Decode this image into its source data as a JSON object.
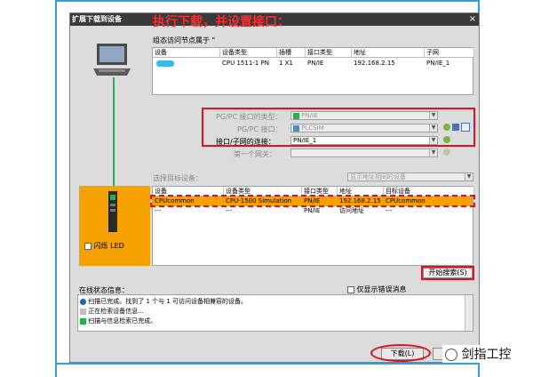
{
  "dialog": {
    "title": "扩展下载到设备",
    "close_glyph": "×"
  },
  "annotation": {
    "title": "执行下载，并设置接口："
  },
  "config_section": {
    "heading": "组态访问节点属于 \"",
    "columns": [
      "设备",
      "设备类型",
      "插槽",
      "接口类型",
      "地址",
      "子网"
    ],
    "row": {
      "device": "",
      "device_type": "CPU 1511-1 PN",
      "slot": "1 X1",
      "interface_type": "PN/IE",
      "address": "192.168.2.15",
      "subnet": "PN/IE_1"
    }
  },
  "interface_settings": {
    "pgpc_type_label": "PG/PC 接口的类型：",
    "pgpc_type_value": "PN/IE",
    "pgpc_interface_label": "PG/PC 接口：",
    "pgpc_interface_value": "PLCSIM",
    "subnet_connection_label": "接口/子网的连接：",
    "subnet_connection_value": "PN/IE_1",
    "gateway_label": "第一个网关："
  },
  "target_section": {
    "heading": "选择目标设备：",
    "filter_value": "显示地址相同的设备",
    "columns": [
      "设备",
      "设备类型",
      "接口类型",
      "地址",
      "目标设备"
    ],
    "rows": [
      {
        "device": "CPUcommon",
        "device_type": "CPU-1500 Simulation",
        "interface_type": "PN/IE",
        "address": "192.168.2.15",
        "target": "CPUcommon"
      },
      {
        "device": "---",
        "device_type": "---",
        "interface_type": "PN/IE",
        "address": "访问地址",
        "target": "---"
      }
    ]
  },
  "flash_led": {
    "label": "闪烁 LED"
  },
  "start_search": {
    "label": "开始搜索(S)"
  },
  "status": {
    "heading": "在线状态信息：",
    "only_errors_label": "仅显示错误消息",
    "messages": [
      "扫描已完成。找到了 1 个与 1 可访问设备相兼容的设备。",
      "正在检索设备信息...",
      "扫描与信息检索已完成。"
    ]
  },
  "download_button": {
    "label": "下载(L)"
  },
  "watermark": {
    "text": "剑指工控"
  },
  "colors": {
    "accent_red": "#e0101c",
    "frame_blue": "#2d9ee6",
    "selected_orange": "#f5a100",
    "link_green": "#22b14c"
  }
}
